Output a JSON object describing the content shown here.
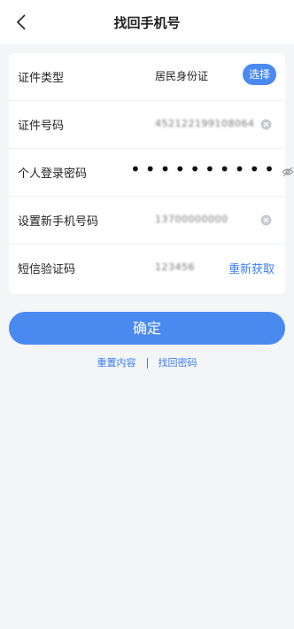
{
  "header": {
    "title": "找回手机号",
    "back_icon": "chevron-left-icon"
  },
  "form": {
    "id_type": {
      "label": "证件类型",
      "value": "居民身份证",
      "select_label": "选择"
    },
    "id_number": {
      "label": "证件号码",
      "value": "452122199108064"
    },
    "password": {
      "label": "个人登录密码",
      "value": "••••••••••"
    },
    "new_phone": {
      "label": "设置新手机号码",
      "value": "13700000000"
    },
    "sms_code": {
      "label": "短信验证码",
      "value": "123456",
      "resend_label": "重新获取"
    }
  },
  "actions": {
    "confirm_label": "确定",
    "reset_label": "重置内容",
    "find_password_label": "找回密码"
  },
  "colors": {
    "accent": "#4a8af0",
    "link": "#3b7df0",
    "background": "#f4f5f7"
  }
}
